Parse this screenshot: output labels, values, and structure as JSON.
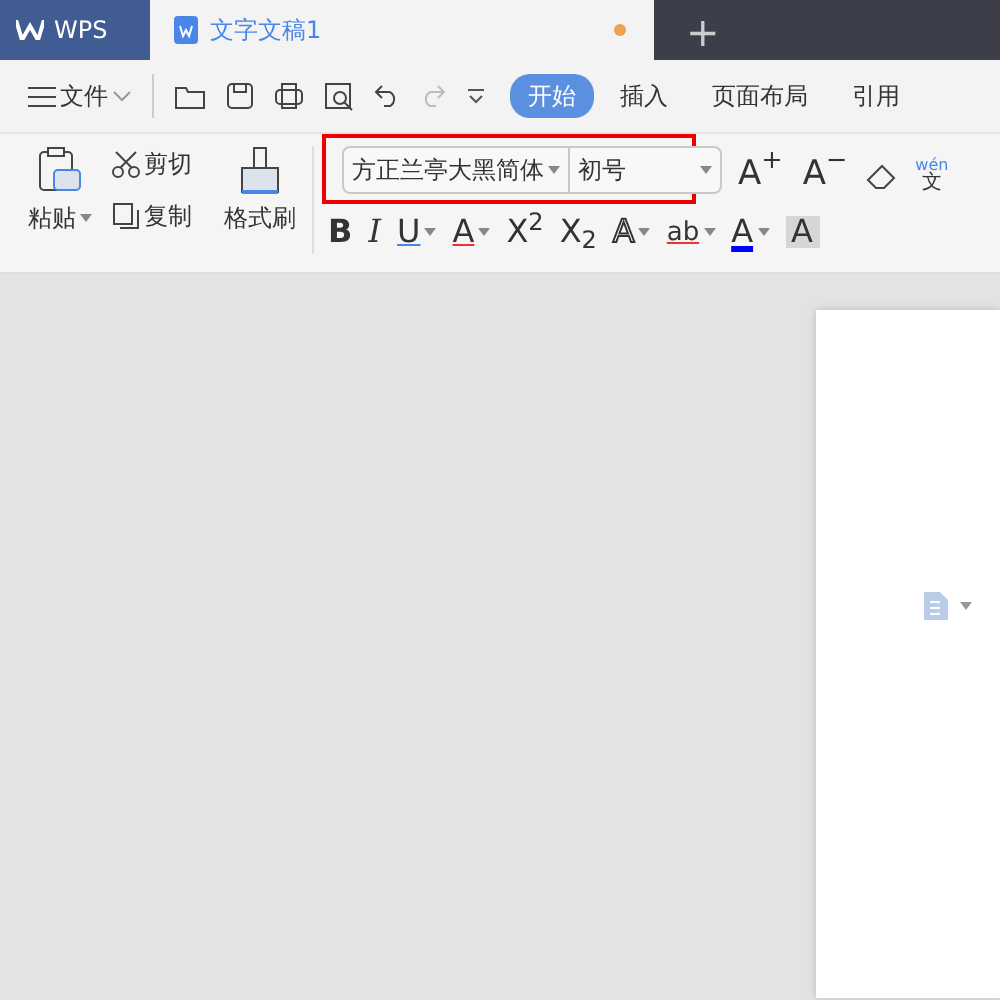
{
  "app_tab": {
    "label": "WPS"
  },
  "document_tab": {
    "title": "文字文稿1",
    "unsaved": true
  },
  "new_tab": {
    "label": "+"
  },
  "menu": {
    "label": "文件"
  },
  "ribbon_tabs": [
    {
      "label": "开始",
      "selected": true
    },
    {
      "label": "插入",
      "selected": false
    },
    {
      "label": "页面布局",
      "selected": false
    },
    {
      "label": "引用",
      "selected": false
    }
  ],
  "clipboard": {
    "paste": "粘贴",
    "cut": "剪切",
    "copy": "复制",
    "format_painter": "格式刷"
  },
  "font": {
    "name": "方正兰亭大黑简体",
    "size": "初号",
    "highlighted": true
  },
  "font_size_buttons": [
    {
      "glyph": "A$^{+}$"
    },
    {
      "glyph": "A$^{−}$"
    }
  ],
  "phonetic": {
    "pinyin": "wén",
    "char": "文"
  },
  "format_buttons": [
    {
      "glyph": "B",
      "kind": "bold",
      "dropdown": false
    },
    {
      "glyph": "I",
      "kind": "italic",
      "dropdown": false
    },
    {
      "glyph": "U",
      "kind": "underline",
      "dropdown": true
    },
    {
      "glyph": "A",
      "kind": "strike",
      "dropdown": true
    },
    {
      "glyph": "X$^{2}$",
      "kind": "plain",
      "dropdown": false
    },
    {
      "glyph": "X$_{2}$",
      "kind": "plain",
      "dropdown": false
    },
    {
      "glyph": "A",
      "kind": "outline",
      "dropdown": true
    },
    {
      "glyph": "ab",
      "kind": "highlight",
      "dropdown": true
    },
    {
      "glyph": "A",
      "kind": "color",
      "dropdown": true
    },
    {
      "glyph": "A",
      "kind": "shade",
      "dropdown": false
    }
  ]
}
